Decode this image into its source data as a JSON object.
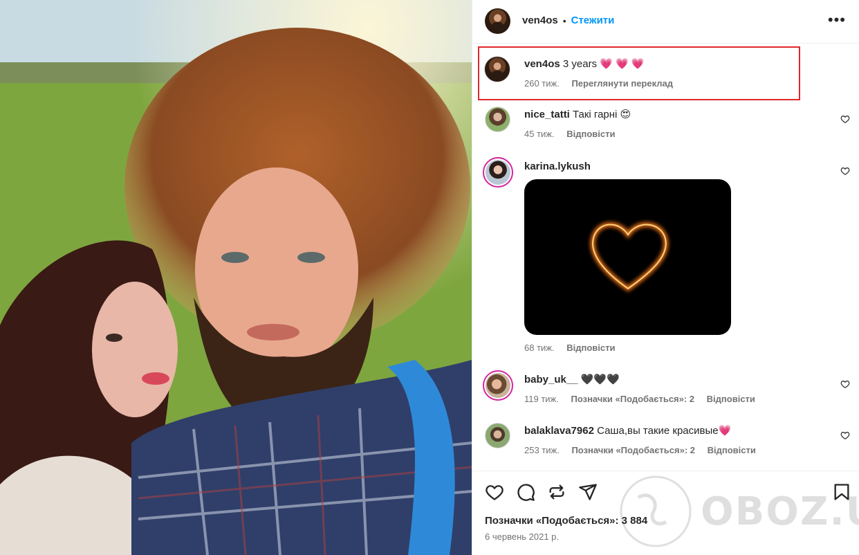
{
  "header": {
    "username": "ven4os",
    "separator": "•",
    "follow_label": "Стежити",
    "more_icon": "more-horizontal-icon"
  },
  "caption": {
    "username": "ven4os",
    "text": "3 years 💗 💗 💗",
    "time": "260 тиж.",
    "translate_label": "Переглянути переклад"
  },
  "comments": [
    {
      "username": "nice_tatti",
      "text": "Такі гарні 😍",
      "time": "45 тиж.",
      "reply_label": "Відповісти"
    },
    {
      "username": "karina.lykush",
      "text": "",
      "time": "68 тиж.",
      "reply_label": "Відповісти"
    },
    {
      "username": "baby_uk__",
      "text": "🖤🖤🖤",
      "time": "119 тиж.",
      "likes_label": "Позначки «Подобається»: 2",
      "reply_label": "Відповісти"
    },
    {
      "username": "balaklava7962",
      "text": "Саша,вы такие красивые💗",
      "time": "253 тиж.",
      "likes_label": "Позначки «Подобається»: 2",
      "reply_label": "Відповісти"
    }
  ],
  "footer": {
    "likes_text": "Позначки «Подобається»: 3 884",
    "date": "6 червень 2021 р."
  },
  "watermark": {
    "text": "OBOZ.UA"
  },
  "colors": {
    "accent": "#0095f6",
    "highlight": "#e0262b",
    "muted": "#737373"
  }
}
